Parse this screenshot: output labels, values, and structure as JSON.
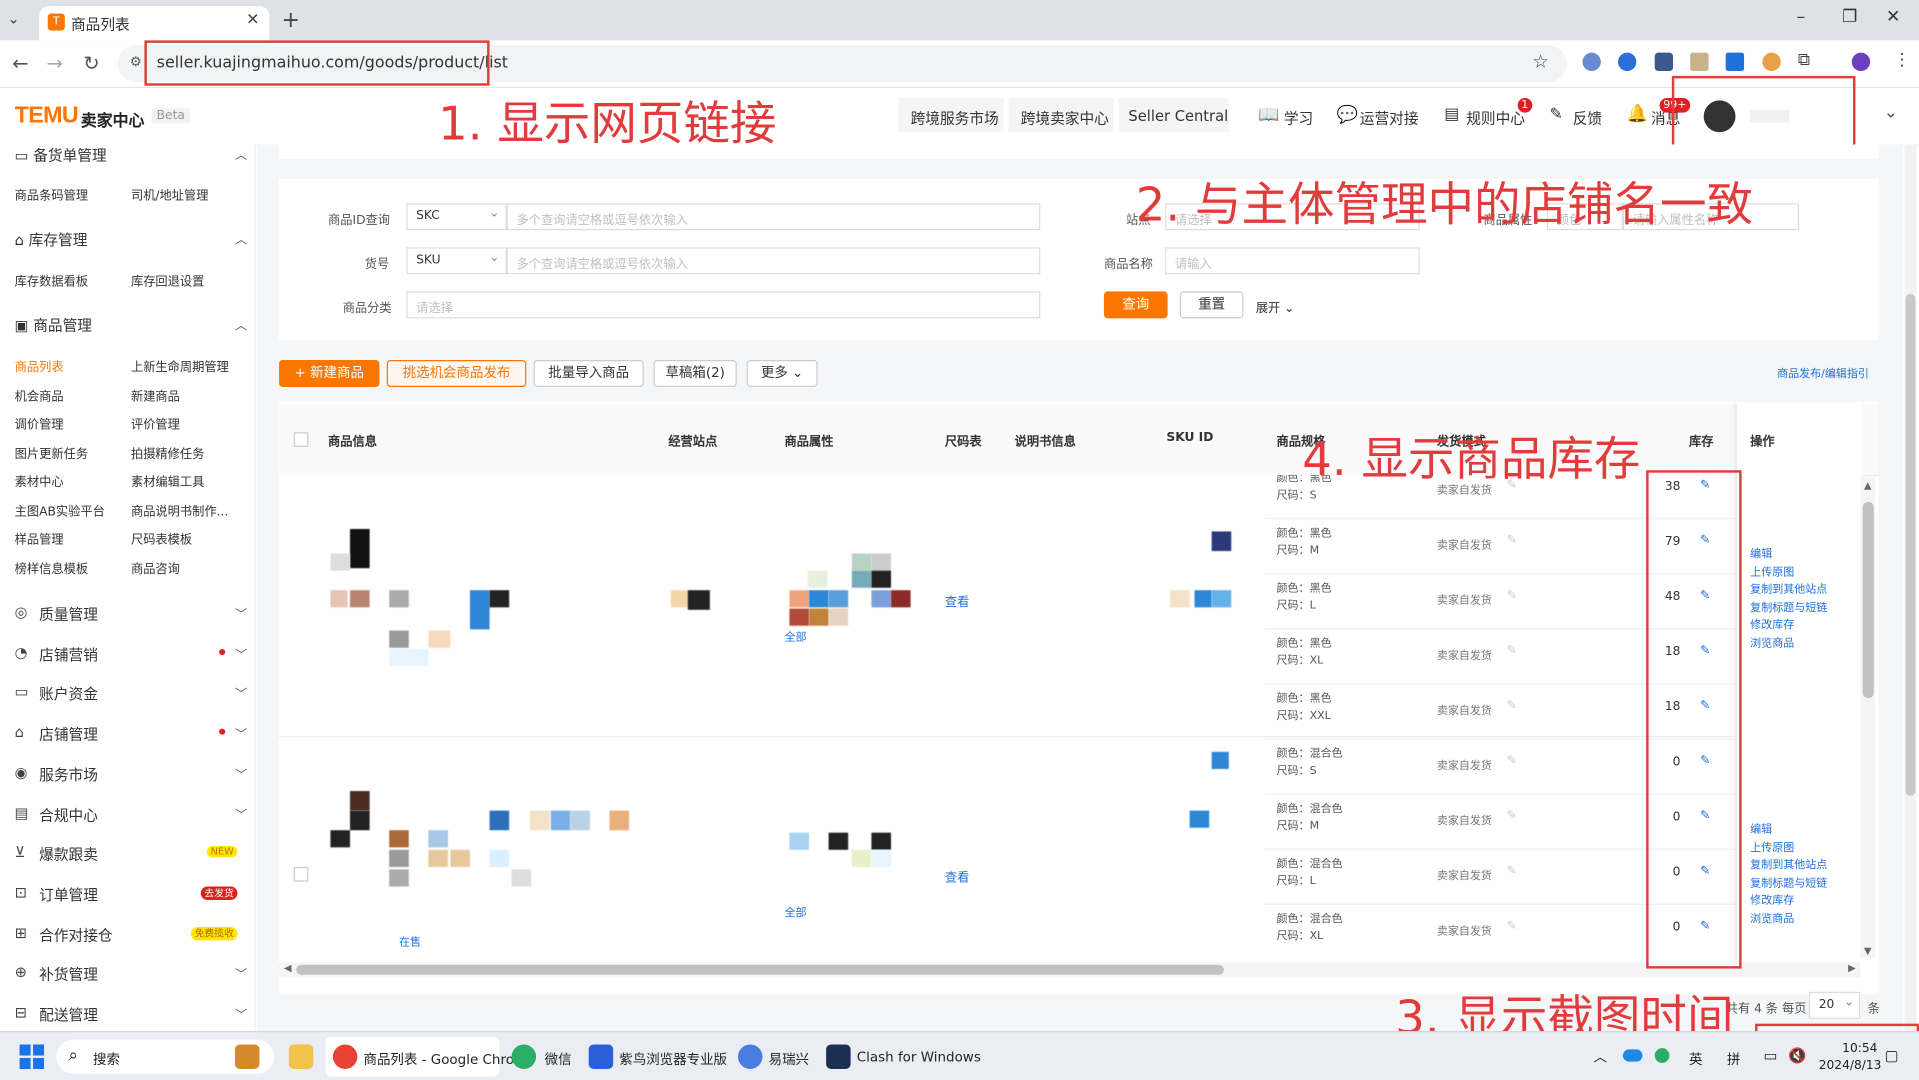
{
  "browser": {
    "tab_title": "商品列表",
    "tab_favicon": "TEMU",
    "new_tab": "+",
    "url": "seller.kuajingmaihuo.com/goods/product/list",
    "window_controls": [
      "–",
      "❐",
      "✕"
    ]
  },
  "header": {
    "logo": "TEMU",
    "subtitle": "卖家中心",
    "beta": "Beta",
    "nav": [
      "跨境服务市场",
      "跨境卖家中心",
      "Seller Central"
    ],
    "tools": [
      {
        "label": "学习",
        "icon": "book-icon"
      },
      {
        "label": "运营对接",
        "icon": "chat-icon"
      },
      {
        "label": "规则中心",
        "icon": "rule-icon",
        "badge": "1"
      },
      {
        "label": "反馈",
        "icon": "feedback-icon"
      },
      {
        "label": "消息",
        "icon": "bell-icon",
        "badge": "99+"
      }
    ]
  },
  "annotations": {
    "a1": "1. 显示网页链接",
    "a2": "2. 与主体管理中的店铺名一致",
    "a3": "3. 显示截图时间",
    "a4": "4. 显示商品库存"
  },
  "sidebar": {
    "partial_top": "备货单管理",
    "top_items": [
      "商品条码管理",
      "司机/地址管理"
    ],
    "inventory": {
      "title": "库存管理",
      "items": [
        "库存数据看板",
        "库存回退设置"
      ]
    },
    "product": {
      "title": "商品管理",
      "items": [
        "商品列表",
        "上新生命周期管理",
        "机会商品",
        "新建商品",
        "调价管理",
        "评价管理",
        "图片更新任务",
        "拍摄精修任务",
        "素材中心",
        "素材编辑工具",
        "主图AB实验平台",
        "商品说明书制作...",
        "样品管理",
        "尺码表模板",
        "榜样信息模板",
        "商品咨询"
      ]
    },
    "sections": [
      {
        "label": "质量管理",
        "icon": "shield-icon"
      },
      {
        "label": "店铺营销",
        "icon": "marketing-icon",
        "dot": true
      },
      {
        "label": "账户资金",
        "icon": "wallet-icon"
      },
      {
        "label": "店铺管理",
        "icon": "store-icon",
        "dot": true
      },
      {
        "label": "服务市场",
        "icon": "service-icon"
      },
      {
        "label": "合规中心",
        "icon": "compliance-icon"
      },
      {
        "label": "爆款跟卖",
        "icon": "cart-icon",
        "tag": "NEW"
      },
      {
        "label": "订单管理",
        "icon": "order-icon",
        "tag": "去发货"
      },
      {
        "label": "合作对接仓",
        "icon": "warehouse-icon",
        "tag": "免费揽收"
      },
      {
        "label": "补货管理",
        "icon": "replenish-icon"
      },
      {
        "label": "配送管理",
        "icon": "delivery-icon"
      }
    ]
  },
  "filters": {
    "id_query_label": "商品ID查询",
    "id_type": "SKC",
    "id_placeholder": "多个查询请空格或逗号依次输入",
    "code_label": "货号",
    "code_type": "SKU",
    "code_placeholder": "多个查询请空格或逗号依次输入",
    "category_label": "商品分类",
    "category_placeholder": "请选择",
    "site_label": "站点",
    "site_placeholder": "请选择",
    "attr_label": "商品属性",
    "attr_type": "颜色",
    "attr_placeholder": "请输入属性名称",
    "name_label": "商品名称",
    "name_placeholder": "请输入",
    "search": "查询",
    "reset": "重置",
    "expand": "展开"
  },
  "toolbar": {
    "new_product": "+ 新建商品",
    "pick_publish": "挑选机会商品发布",
    "batch_import": "批量导入商品",
    "drafts": "草稿箱(2)",
    "more": "更多",
    "guide": "商品发布/编辑指引"
  },
  "table": {
    "headers": [
      "商品信息",
      "经营站点",
      "商品属性",
      "尺码表",
      "说明书信息",
      "SKU ID",
      "商品规格",
      "发货模式",
      "库存",
      "操作"
    ],
    "view": "查看",
    "all": "全部",
    "on_sale": "在售",
    "ops": [
      "编辑",
      "上传原图",
      "复制到其他站点",
      "复制标题与短链",
      "修改库存",
      "浏览商品"
    ],
    "rows": [
      {
        "color": "颜色：黑色",
        "size": "尺码：S",
        "ship": "卖家自发货",
        "stock": "38"
      },
      {
        "color": "颜色：黑色",
        "size": "尺码：M",
        "ship": "卖家自发货",
        "stock": "79"
      },
      {
        "color": "颜色：黑色",
        "size": "尺码：L",
        "ship": "卖家自发货",
        "stock": "48"
      },
      {
        "color": "颜色：黑色",
        "size": "尺码：XL",
        "ship": "卖家自发货",
        "stock": "18"
      },
      {
        "color": "颜色：黑色",
        "size": "尺码：XXL",
        "ship": "卖家自发货",
        "stock": "18"
      },
      {
        "color": "颜色：混合色",
        "size": "尺码：S",
        "ship": "卖家自发货",
        "stock": "0"
      },
      {
        "color": "颜色：混合色",
        "size": "尺码：M",
        "ship": "卖家自发货",
        "stock": "0"
      },
      {
        "color": "颜色：混合色",
        "size": "尺码：L",
        "ship": "卖家自发货",
        "stock": "0"
      },
      {
        "color": "颜色：混合色",
        "size": "尺码：XL",
        "ship": "卖家自发货",
        "stock": "0"
      }
    ]
  },
  "pagination": {
    "total": "共有 4 条",
    "per_page": "每页",
    "size": "20",
    "unit": "条"
  },
  "taskbar": {
    "search": "搜索",
    "apps": [
      "商品列表 - Google Chro",
      "微信",
      "紫鸟浏览器专业版",
      "易瑞兴",
      "Clash for Windows"
    ],
    "ime1": "英",
    "ime2": "拼",
    "time": "10:54",
    "date": "2024/8/13"
  },
  "colors": {
    "brand": "#fb7701",
    "annotation": "#e23b3b",
    "link": "#1f6fd8"
  }
}
